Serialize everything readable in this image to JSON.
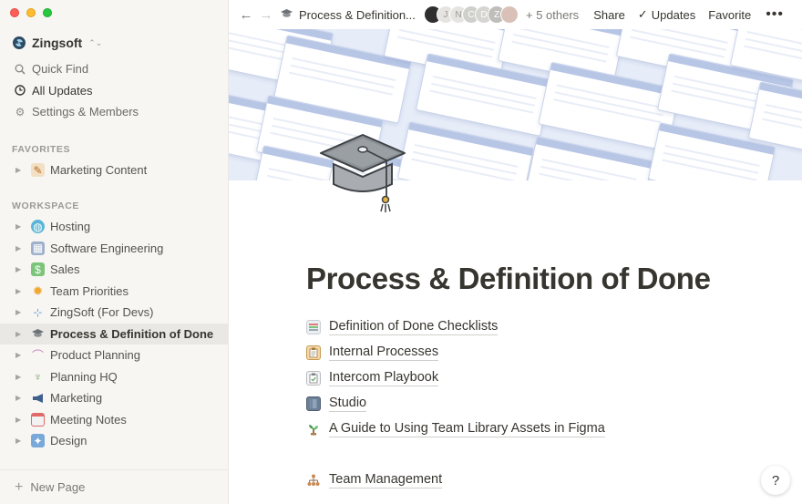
{
  "workspace": {
    "name": "Zingsoft"
  },
  "nav": [
    {
      "icon": "search-icon",
      "label": "Quick Find"
    },
    {
      "icon": "clock-icon",
      "label": "All Updates"
    },
    {
      "icon": "gear-icon",
      "label": "Settings & Members"
    }
  ],
  "favorites": {
    "label": "FAVORITES",
    "items": [
      {
        "icon": "marketing-icon",
        "label": "Marketing Content"
      }
    ]
  },
  "workspace_section": {
    "label": "WORKSPACE",
    "items": [
      {
        "icon": "globe-icon",
        "label": "Hosting"
      },
      {
        "icon": "computer-icon",
        "label": "Software Engineering"
      },
      {
        "icon": "money-icon",
        "label": "Sales"
      },
      {
        "icon": "sun-icon",
        "label": "Team Priorities"
      },
      {
        "icon": "tree-icon",
        "label": "ZingSoft (For Devs)"
      },
      {
        "icon": "graduation-cap-icon",
        "label": "Process & Definition of Done"
      },
      {
        "icon": "palette-icon",
        "label": "Product Planning"
      },
      {
        "icon": "trophy-icon",
        "label": "Planning HQ"
      },
      {
        "icon": "megaphone-icon",
        "label": "Marketing"
      },
      {
        "icon": "calendar-icon",
        "label": "Meeting Notes"
      },
      {
        "icon": "design-icon",
        "label": "Design"
      }
    ]
  },
  "new_page": {
    "label": "New Page"
  },
  "topbar": {
    "breadcrumb": "Process & Definition...",
    "avatars": [
      "",
      "J",
      "N",
      "C",
      "D",
      "Z",
      ""
    ],
    "others": "+ 5 others",
    "share": "Share",
    "updates": "Updates",
    "favorite": "Favorite",
    "more": "•••"
  },
  "page": {
    "title": "Process & Definition of Done",
    "links": [
      {
        "icon": "checklist-icon",
        "label": "Definition of Done Checklists"
      },
      {
        "icon": "clipboard-icon",
        "label": "Internal Processes"
      },
      {
        "icon": "clipboard-check-icon",
        "label": "Intercom Playbook"
      },
      {
        "icon": "book-icon",
        "label": "Studio"
      },
      {
        "icon": "plant-icon",
        "label": "A Guide to Using Team Library Assets in Figma"
      },
      {
        "icon": "org-chart-icon",
        "label": "Team Management"
      }
    ]
  },
  "help": {
    "label": "?"
  }
}
